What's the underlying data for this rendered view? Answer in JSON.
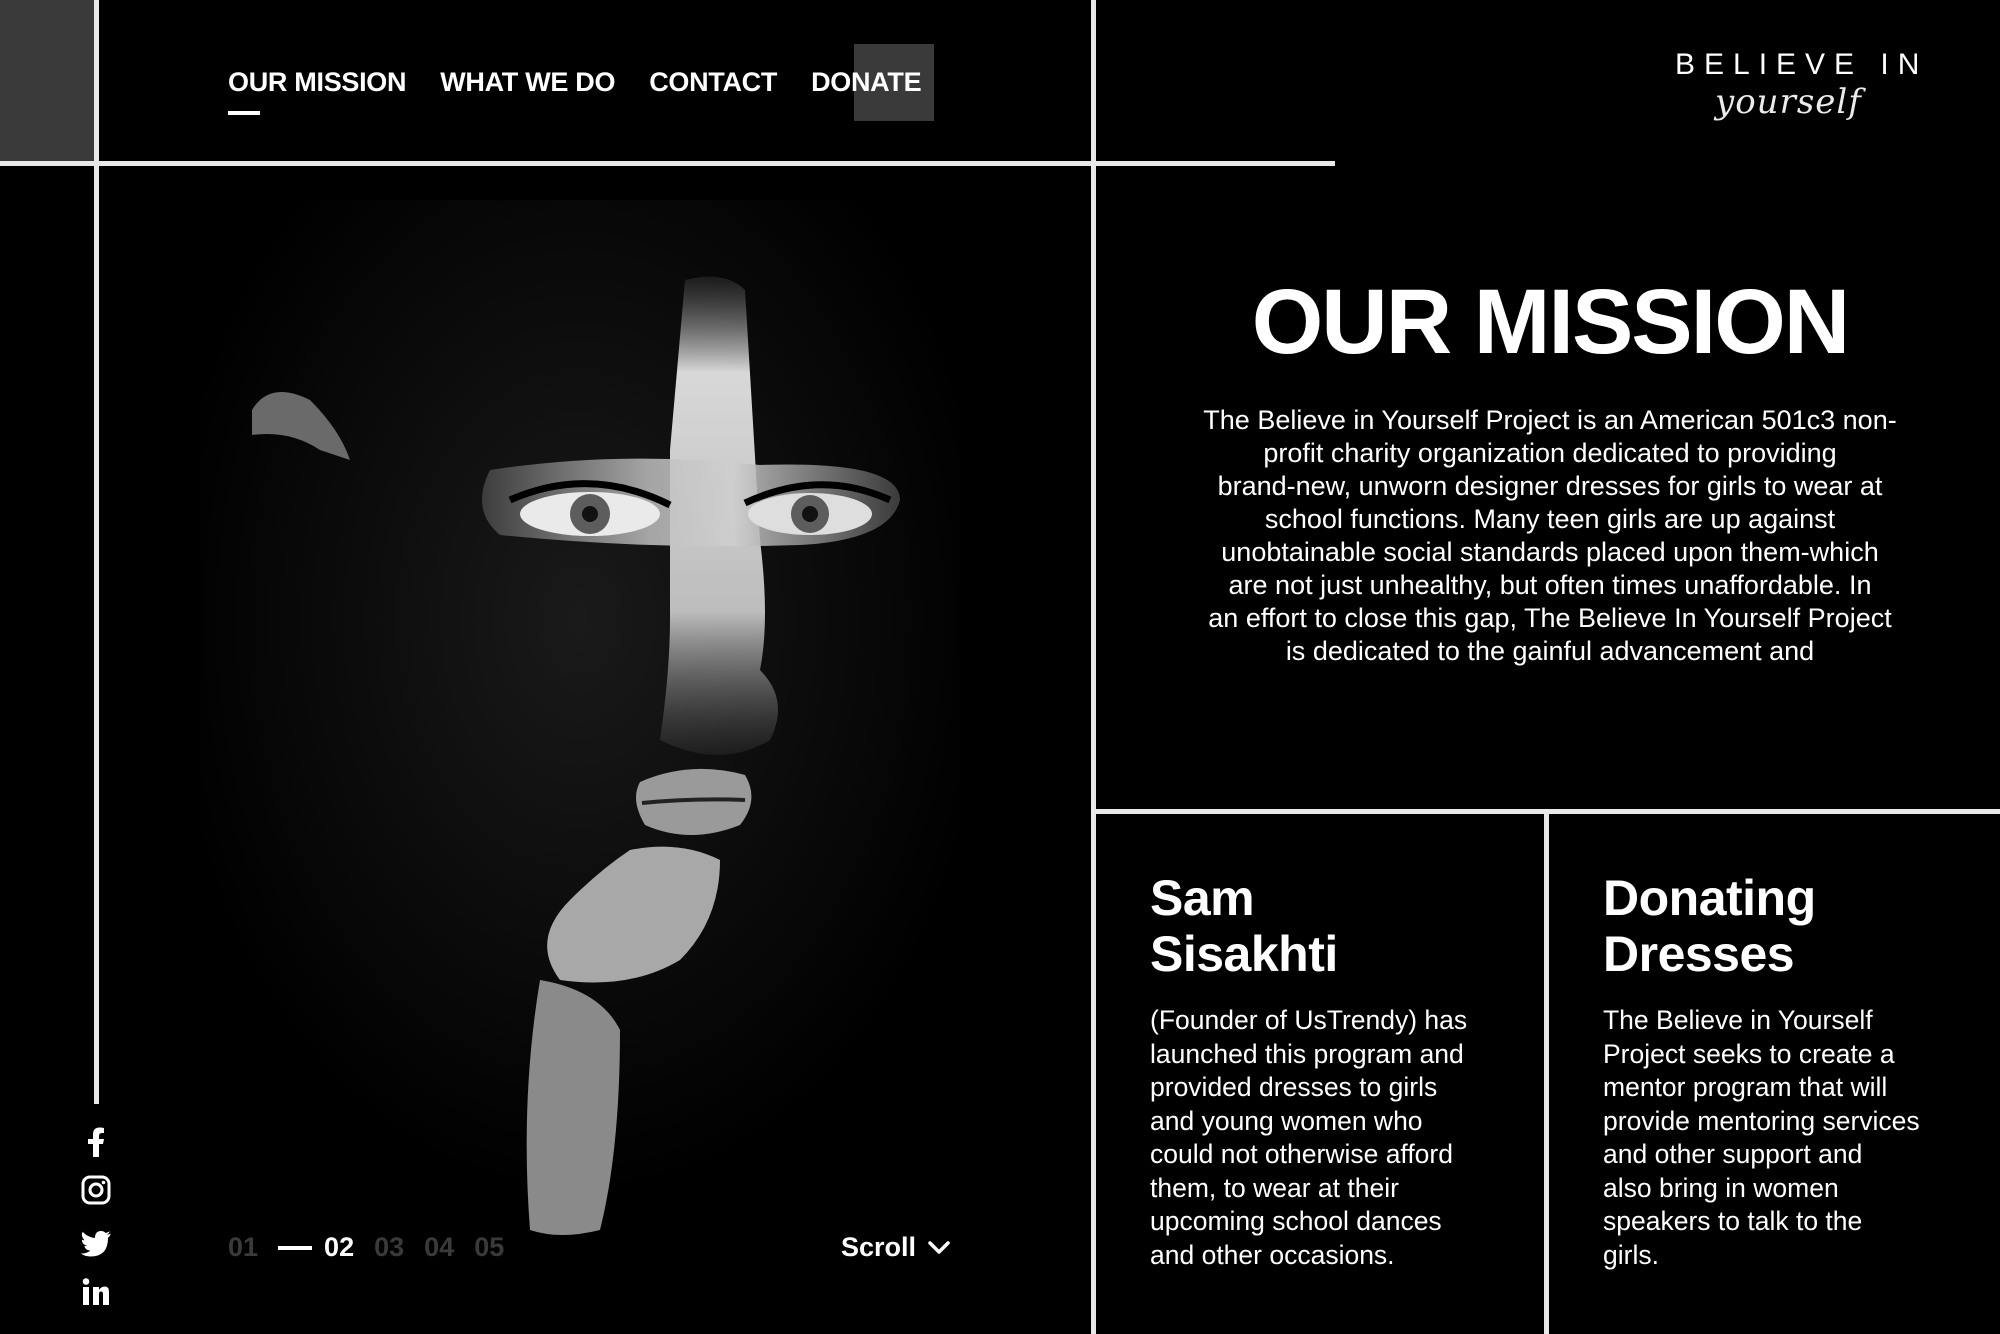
{
  "nav": {
    "items": [
      {
        "label": "OUR MISSION",
        "active": true
      },
      {
        "label": "WHAT WE DO",
        "active": false
      },
      {
        "label": "CONTACT",
        "active": false
      },
      {
        "label": "DONATE",
        "active": false
      }
    ]
  },
  "logo": {
    "title": "BELIEVE IN",
    "script": "yourself"
  },
  "mission": {
    "title": "OUR MISSION",
    "lines": [
      "The Believe in Yourself Project is an American 501c3 non-",
      "profit charity organization dedicated to providing",
      "brand-new, unworn designer dresses for girls to wear at",
      "school functions. Many teen girls are up against",
      "unobtainable social standards placed upon them-which",
      "are not just unhealthy, but often times unaffordable. In",
      "an effort to close this gap, The Believe In Yourself Project",
      "is dedicated to the gainful advancement and"
    ]
  },
  "panel_founder": {
    "title_line1": "Sam",
    "title_line2": "Sisakhti",
    "lines": [
      "(Founder of UsTrendy) has",
      "launched this program and",
      "provided dresses to girls",
      "and young women who",
      "could not otherwise afford",
      "them, to wear at their",
      "upcoming school dances",
      "and other occasions."
    ]
  },
  "panel_donating": {
    "title_line1": "Donating",
    "title_line2": "Dresses",
    "lines": [
      "The Believe in Yourself",
      "Project seeks to create a",
      "mentor program that will",
      "provide mentoring services",
      "and other support and",
      "also bring in women",
      "speakers to talk to the",
      "girls."
    ]
  },
  "slides": {
    "items": [
      "01",
      "02",
      "03",
      "04",
      "05"
    ],
    "active": "02"
  },
  "scroll": {
    "label": "Scroll"
  },
  "social": {
    "icons": [
      "facebook-icon",
      "instagram-icon",
      "twitter-icon",
      "linkedin-icon"
    ]
  },
  "colors": {
    "background": "#000000",
    "text": "#ffffff",
    "accent_grey": "#3a3a3a",
    "inactive_slide": "#3a3a3a"
  }
}
